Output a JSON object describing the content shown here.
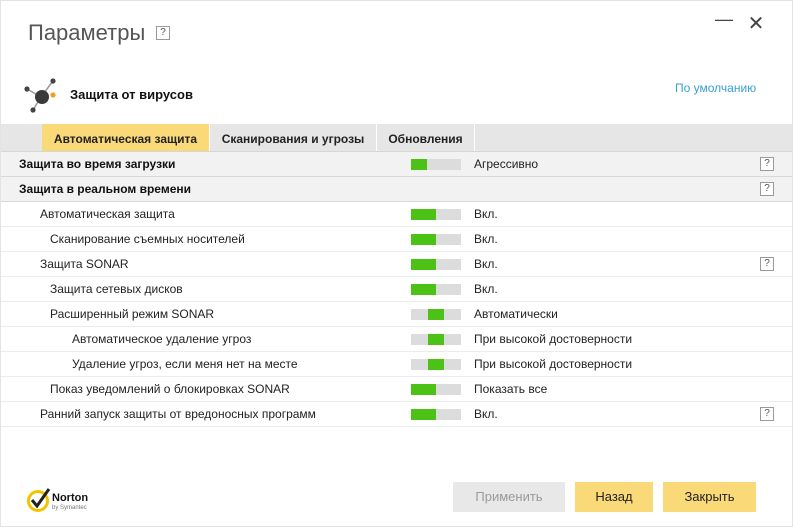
{
  "window": {
    "title": "Параметры",
    "help_label": "?",
    "minimize_label": "—",
    "close_label": "✕"
  },
  "section": {
    "title": "Защита от вирусов",
    "icon": "atom-network-icon",
    "default_link": "По умолчанию"
  },
  "tabs": [
    {
      "label": "Автоматическая защита",
      "active": true
    },
    {
      "label": "Сканирования и угрозы",
      "active": false
    },
    {
      "label": "Обновления",
      "active": false
    }
  ],
  "rows": [
    {
      "label": "Защита во время загрузки",
      "value": "Агрессивно",
      "type": "header",
      "help": "?"
    },
    {
      "label": "Защита в реальном времени",
      "type": "header",
      "help": "?"
    },
    {
      "label": "Автоматическая защита",
      "value": "Вкл."
    },
    {
      "label": "Сканирование съемных носителей",
      "value": "Вкл."
    },
    {
      "label": "Защита SONAR",
      "value": "Вкл.",
      "help": "?"
    },
    {
      "label": "Защита сетевых дисков",
      "value": "Вкл."
    },
    {
      "label": "Расширенный режим SONAR",
      "value": "Автоматически"
    },
    {
      "label": "Автоматическое удаление угроз",
      "value": "При высокой достоверности"
    },
    {
      "label": "Удаление угроз, если меня нет на месте",
      "value": "При высокой достоверности"
    },
    {
      "label": "Показ уведомлений о блокировках SONAR",
      "value": "Показать все"
    },
    {
      "label": "Ранний запуск защиты от вредоносных программ",
      "value": "Вкл.",
      "help": "?"
    }
  ],
  "buttons": {
    "apply": "Применить",
    "back": "Назад",
    "close": "Закрыть"
  },
  "brand": {
    "name": "Norton",
    "sub": "by Symantec"
  },
  "colors": {
    "accent": "#fad978",
    "switch_on": "#4cc116",
    "switch_track": "#dcdcdc",
    "link": "#3aa0d0"
  }
}
